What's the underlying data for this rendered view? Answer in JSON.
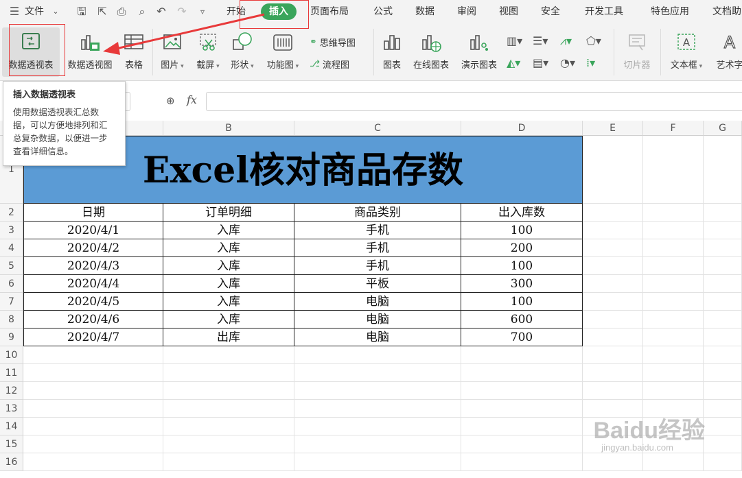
{
  "menubar": {
    "file_label": "文件",
    "items": [
      "开始",
      "插入",
      "页面布局",
      "公式",
      "数据",
      "审阅",
      "视图",
      "安全",
      "开发工具",
      "特色应用",
      "文档助"
    ],
    "active_tab": "插入"
  },
  "ribbon": {
    "pivot_table": "数据透视表",
    "pivot_chart": "数据透视图",
    "table": "表格",
    "picture": "图片",
    "screenshot": "截屏",
    "shape": "形状",
    "function_chart": "功能图",
    "mindmap": "思维导图",
    "flowchart": "流程图",
    "chart": "图表",
    "online_chart": "在线图表",
    "demo_chart": "演示图表",
    "slicer": "切片器",
    "textbox": "文本框",
    "wordart": "艺术字"
  },
  "formulabar": {
    "fx_label": "fx"
  },
  "tooltip": {
    "title": "插入数据透视表",
    "body": "使用数据透视表汇总数据，可以方便地排列和汇总复杂数据，以便进一步查看详细信息。"
  },
  "sheet": {
    "columns": [
      "B",
      "C",
      "D",
      "E",
      "F",
      "G"
    ],
    "rows": [
      "1",
      "2",
      "3",
      "4",
      "5",
      "6",
      "7",
      "8",
      "9",
      "10",
      "11",
      "12",
      "13",
      "14",
      "15",
      "16"
    ],
    "title": "Excel核对商品存数",
    "headers": [
      "日期",
      "订单明细",
      "商品类别",
      "出入库数"
    ],
    "data": [
      [
        "2020/4/1",
        "入库",
        "手机",
        "100"
      ],
      [
        "2020/4/2",
        "入库",
        "手机",
        "200"
      ],
      [
        "2020/4/3",
        "入库",
        "手机",
        "100"
      ],
      [
        "2020/4/4",
        "入库",
        "平板",
        "300"
      ],
      [
        "2020/4/5",
        "入库",
        "电脑",
        "100"
      ],
      [
        "2020/4/6",
        "入库",
        "电脑",
        "600"
      ],
      [
        "2020/4/7",
        "出库",
        "电脑",
        "700"
      ]
    ],
    "title_fill": "#5b9bd5"
  },
  "watermark": {
    "brand": "Baidu经验",
    "url": "jingyan.baidu.com"
  }
}
